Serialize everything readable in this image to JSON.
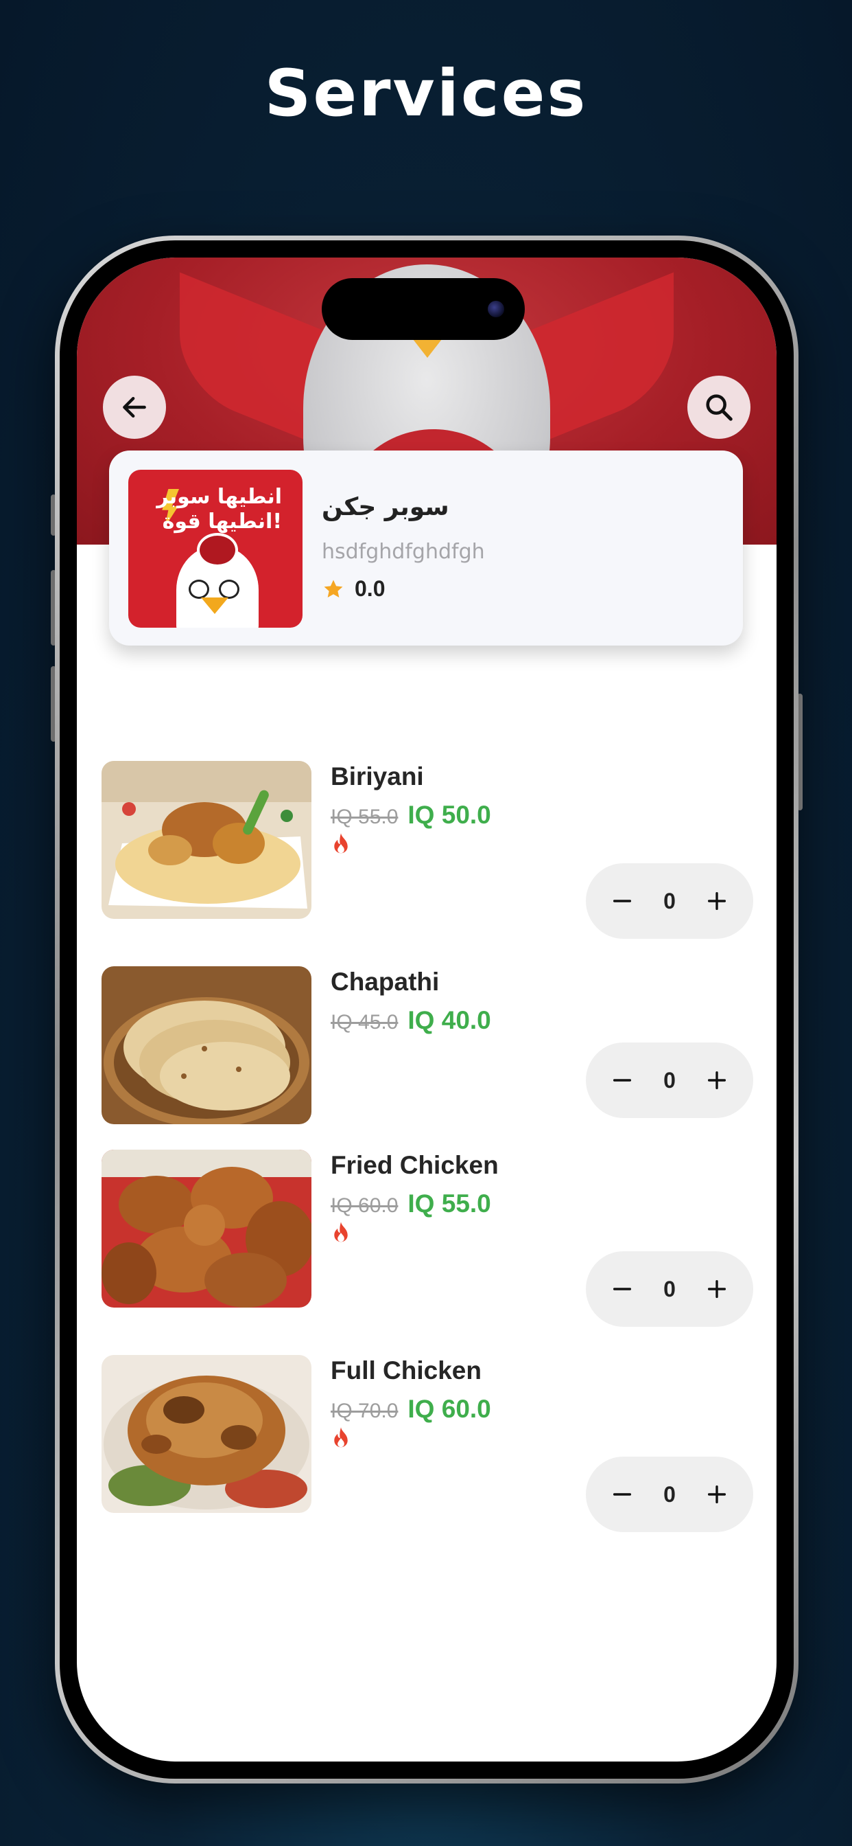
{
  "page_heading": "Services",
  "header": {
    "back_icon": "arrow-left-icon",
    "search_icon": "search-icon"
  },
  "restaurant": {
    "logo_text_line1": "انطيها سوبر",
    "logo_text_line2": "انطيها قوة!",
    "name": "سوبر جكن",
    "description": "hsdfghdfghdfgh",
    "rating": "0.0",
    "star_color": "#f5a623"
  },
  "items": [
    {
      "name": "Biriyani",
      "old_price": "IQ 55.0",
      "new_price": "IQ 50.0",
      "hot": true,
      "quantity": "0"
    },
    {
      "name": "Chapathi",
      "old_price": "IQ 45.0",
      "new_price": "IQ 40.0",
      "hot": false,
      "quantity": "0"
    },
    {
      "name": "Fried Chicken",
      "old_price": "IQ 60.0",
      "new_price": "IQ 55.0",
      "hot": true,
      "quantity": "0"
    },
    {
      "name": "Full Chicken",
      "old_price": "IQ 70.0",
      "new_price": "IQ 60.0",
      "hot": true,
      "quantity": "0"
    }
  ],
  "colors": {
    "accent_green": "#3fae4c",
    "brand_red": "#a61f27",
    "flame_red": "#e8432e"
  }
}
